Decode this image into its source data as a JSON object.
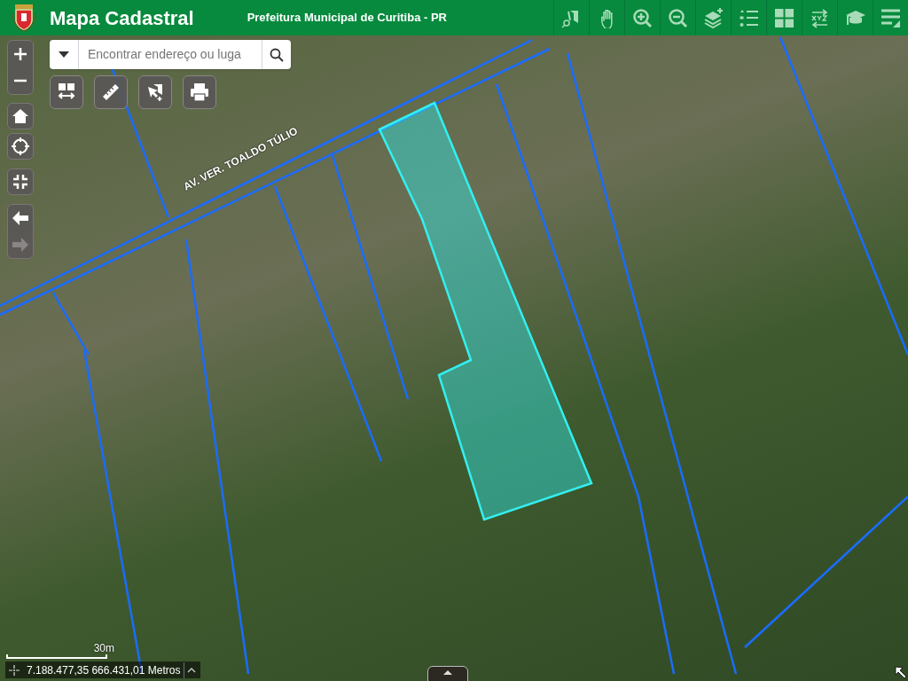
{
  "header": {
    "title": "Mapa Cadastral",
    "subtitle": "Prefeitura Municipal de Curitiba - PR",
    "tools": [
      {
        "kind": "identify"
      },
      {
        "kind": "pan"
      },
      {
        "kind": "zoomin"
      },
      {
        "kind": "zoomout"
      },
      {
        "kind": "layers"
      },
      {
        "kind": "legend"
      },
      {
        "kind": "basemap"
      },
      {
        "kind": "coords"
      },
      {
        "kind": "learn"
      },
      {
        "kind": "menu"
      }
    ]
  },
  "map": {
    "street_label": "AV. VER. TOALDO TÚLIO",
    "nav": [
      {
        "kind": "back",
        "disabled": false
      },
      {
        "kind": "forward",
        "disabled": true
      }
    ],
    "search": {
      "placeholder": "Encontrar endereço ou luga"
    },
    "tools": [
      {
        "kind": "swipe"
      },
      {
        "kind": "measure"
      },
      {
        "kind": "select"
      },
      {
        "kind": "print"
      }
    ],
    "scale": "30m",
    "coordinates": "7.188.477,35 666.431,01 Metros"
  }
}
